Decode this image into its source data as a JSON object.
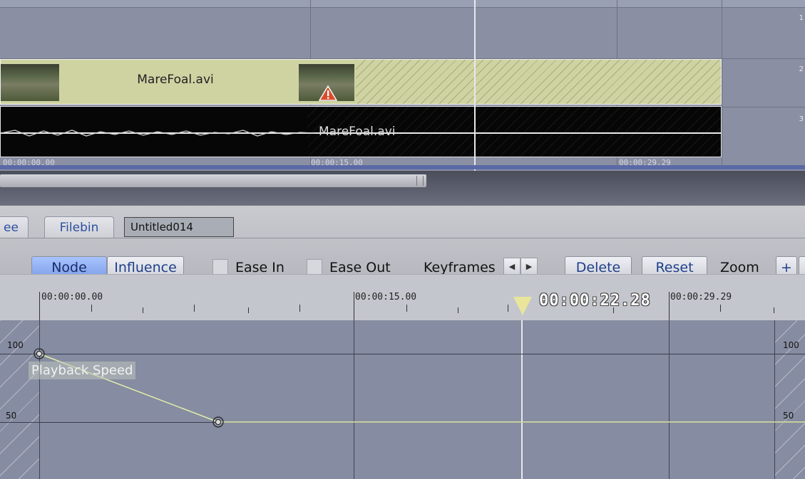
{
  "timeline": {
    "track_numbers": [
      "1",
      "2",
      "3"
    ],
    "video_clip_name": "MareFoal.avi",
    "audio_clip_name": "MareFoal.avi",
    "timecodes": [
      "00:00:00.00",
      "00:00:15.00",
      "00:00:29.29"
    ]
  },
  "tabs": {
    "partial_tab": "ee",
    "filebin": "Filebin",
    "name_field": "Untitled014"
  },
  "toolbar": {
    "node": "Node",
    "influence": "Influence",
    "ease_in": "Ease In",
    "ease_out": "Ease Out",
    "keyframes": "Keyframes",
    "prev_keyframe": "◀",
    "next_keyframe": "▶",
    "delete": "Delete",
    "reset": "Reset",
    "zoom": "Zoom",
    "zoom_in": "+"
  },
  "graph": {
    "ruler_timecodes": [
      "00:00:00.00",
      "00:00:15.00",
      "00:00:29.29"
    ],
    "current_time": "00:00:22.28",
    "y_labels_left": [
      "100",
      "50"
    ],
    "y_labels_right": [
      "100",
      "50"
    ],
    "curve_name": "Playback Speed",
    "keyframes": [
      {
        "time": "00:00:00.00",
        "value": 100
      },
      {
        "time": "00:00:08.00",
        "value": 50
      }
    ],
    "curve_color": "#e6f0a8"
  },
  "colors": {
    "accent": "#7d9fe8",
    "clip": "#cfd3a2",
    "audio": "#060606"
  }
}
